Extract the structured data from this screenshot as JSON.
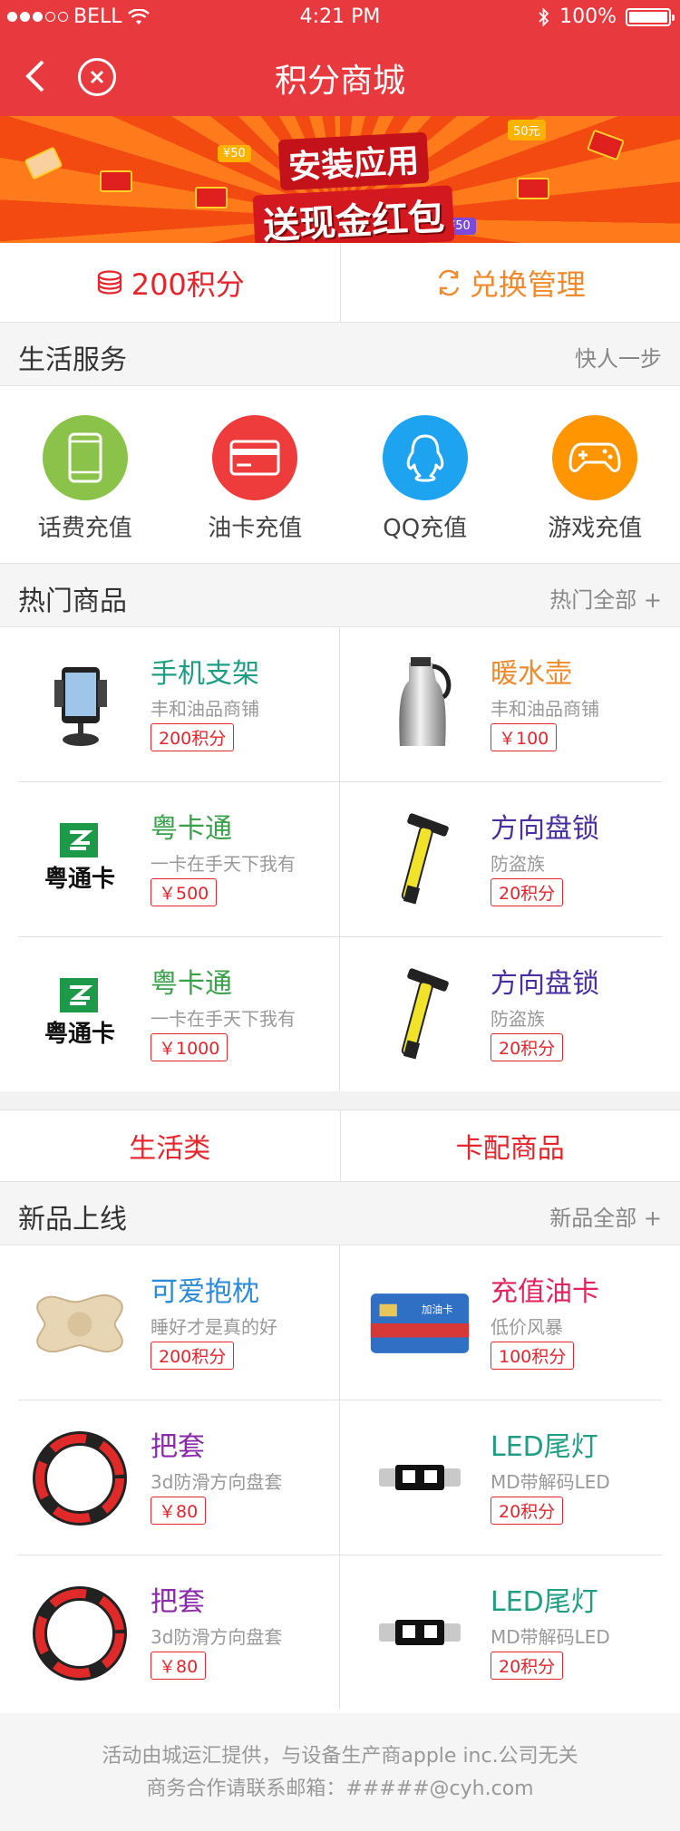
{
  "status_bar": {
    "carrier": "BELL",
    "time": "4:21 PM",
    "battery": "100%"
  },
  "nav": {
    "title": "积分商城"
  },
  "banner": {
    "line1": "安装应用",
    "line2": "送现金红包",
    "tag1": "¥50",
    "tag2": "50元",
    "tag3": "¥50"
  },
  "points": {
    "balance": "200积分",
    "exchange": "兑换管理"
  },
  "life_service": {
    "title": "生活服务",
    "more": "快人一步",
    "items": [
      {
        "label": "话费充值",
        "icon": "phone-icon",
        "color": "#8bc34a"
      },
      {
        "label": "油卡充值",
        "icon": "card-icon",
        "color": "#ee3b3b"
      },
      {
        "label": "QQ充值",
        "icon": "qq-icon",
        "color": "#1ea3f0"
      },
      {
        "label": "游戏充值",
        "icon": "gamepad-icon",
        "color": "#ff9500"
      }
    ]
  },
  "hot": {
    "title": "热门商品",
    "more": "热门全部 +",
    "items": [
      {
        "name": "手机支架",
        "shop": "丰和油品商铺",
        "price": "200积分",
        "color": "#1f9e84",
        "icon": "phone-holder-icon"
      },
      {
        "name": "暖水壶",
        "shop": "丰和油品商铺",
        "price": "￥100",
        "color": "#f08a2c",
        "icon": "thermos-icon"
      },
      {
        "name": "粤卡通",
        "shop": "一卡在手天下我有",
        "price": "￥500",
        "color": "#3aa04a",
        "icon": "yuetong-card-icon"
      },
      {
        "name": "方向盘锁",
        "shop": "防盗族",
        "price": "20积分",
        "color": "#4a2ea0",
        "icon": "steering-lock-icon"
      },
      {
        "name": "粤卡通",
        "shop": "一卡在手天下我有",
        "price": "￥1000",
        "color": "#3aa04a",
        "icon": "yuetong-card-icon"
      },
      {
        "name": "方向盘锁",
        "shop": "防盗族",
        "price": "20积分",
        "color": "#4a2ea0",
        "icon": "steering-lock-icon"
      }
    ]
  },
  "categories": {
    "left": "生活类",
    "right": "卡配商品"
  },
  "new": {
    "title": "新品上线",
    "more": "新品全部 +",
    "items": [
      {
        "name": "可爱抱枕",
        "shop": "睡好才是真的好",
        "price": "200积分",
        "color": "#2a8ad8",
        "icon": "pillow-icon"
      },
      {
        "name": "充值油卡",
        "shop": "低价风暴",
        "price": "100积分",
        "color": "#e0245e",
        "icon": "fuel-card-icon"
      },
      {
        "name": "把套",
        "shop": "3d防滑方向盘套",
        "price": "￥80",
        "color": "#8a2aa8",
        "icon": "wheel-cover-icon"
      },
      {
        "name": "LED尾灯",
        "shop": "MD带解码LED",
        "price": "20积分",
        "color": "#1f9e84",
        "icon": "led-bulb-icon"
      },
      {
        "name": "把套",
        "shop": "3d防滑方向盘套",
        "price": "￥80",
        "color": "#8a2aa8",
        "icon": "wheel-cover-icon"
      },
      {
        "name": "LED尾灯",
        "shop": "MD带解码LED",
        "price": "20积分",
        "color": "#1f9e84",
        "icon": "led-bulb-icon"
      }
    ]
  },
  "footer": {
    "line1": "活动由城运汇提供，与设备生产商apple inc.公司无关",
    "line2": "商务合作请联系邮箱：#####@cyh.com"
  }
}
